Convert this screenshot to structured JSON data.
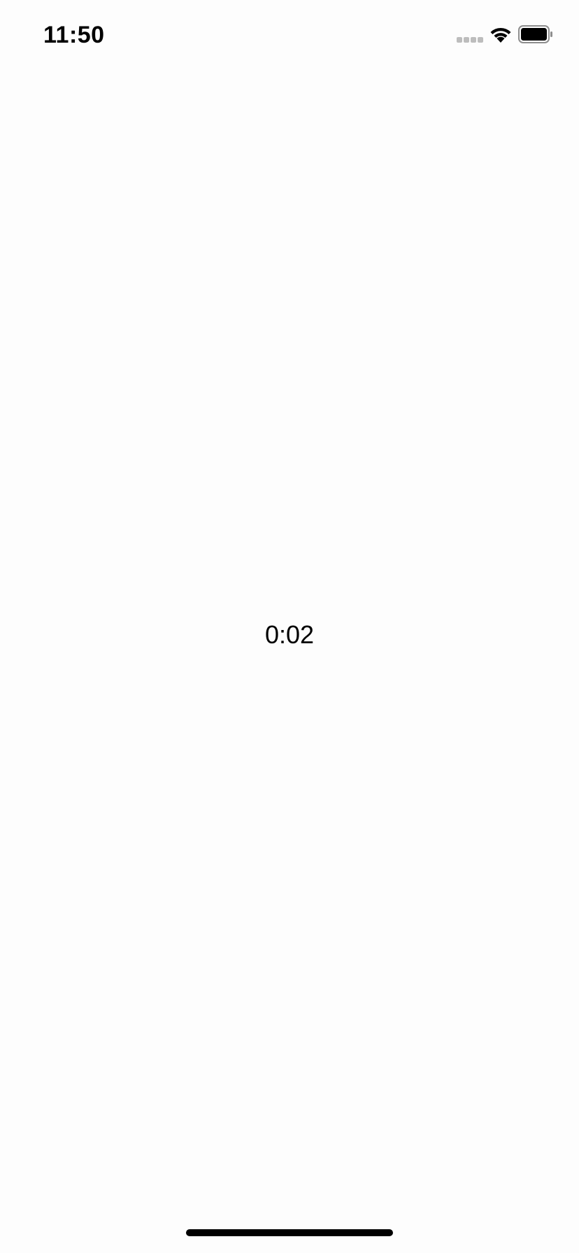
{
  "status_bar": {
    "time": "11:50",
    "signal_icon": "cellular-signal-icon",
    "wifi_icon": "wifi-icon",
    "battery_icon": "battery-icon",
    "colors": {
      "signal_inactive": "#bdbdbd",
      "foreground": "#000000"
    }
  },
  "main": {
    "timer_text": "0:02"
  },
  "home_indicator": {
    "icon": "home-indicator-bar"
  }
}
